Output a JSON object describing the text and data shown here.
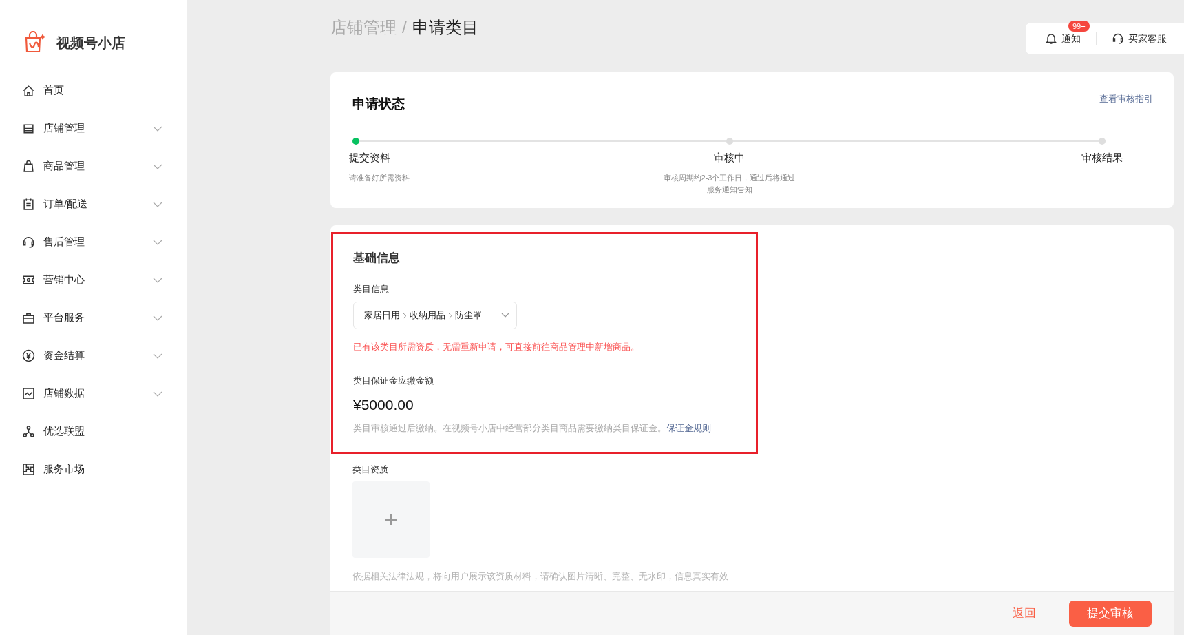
{
  "sidebar": {
    "app_name": "视频号小店",
    "items": [
      {
        "label": "首页",
        "expandable": false
      },
      {
        "label": "店铺管理",
        "expandable": true
      },
      {
        "label": "商品管理",
        "expandable": true
      },
      {
        "label": "订单/配送",
        "expandable": true
      },
      {
        "label": "售后管理",
        "expandable": true
      },
      {
        "label": "营销中心",
        "expandable": true
      },
      {
        "label": "平台服务",
        "expandable": true
      },
      {
        "label": "资金结算",
        "expandable": true
      },
      {
        "label": "店铺数据",
        "expandable": true
      },
      {
        "label": "优选联盟",
        "expandable": false
      },
      {
        "label": "服务市场",
        "expandable": false
      }
    ]
  },
  "breadcrumb": {
    "parent": "店铺管理",
    "separator": "/",
    "current": "申请类目"
  },
  "top_actions": {
    "notifications": {
      "label": "通知",
      "badge": "99+"
    },
    "support": {
      "label": "买家客服"
    }
  },
  "status_card": {
    "title": "申请状态",
    "guide_link": "查看审核指引",
    "steps": [
      {
        "label": "提交资料",
        "note": "请准备好所需资料",
        "active": true
      },
      {
        "label": "审核中",
        "note": "审核周期约2-3个工作日，通过后将通过服务通知告知",
        "active": false
      },
      {
        "label": "审核结果",
        "active": false
      }
    ]
  },
  "basic_info": {
    "title": "基础信息",
    "highlighted": true,
    "category_label": "类目信息",
    "category_path": [
      "家居日用",
      "收纳用品",
      "防尘罩"
    ],
    "warning": "已有该类目所需资质，无需重新申请，可直接前往商品管理中新增商品。",
    "deposit_label": "类目保证金应缴金额",
    "deposit_amount": "¥5000.00",
    "deposit_note": "类目审核通过后缴纳。在视频号小店中经营部分类目商品需要缴纳类目保证金。",
    "deposit_link": "保证金规则",
    "qualification_label": "类目资质",
    "upload_symbol": "+",
    "qualification_note": "依据相关法律法规，将向用户展示该资质材料，请确认图片清晰、完整、无水印，信息真实有效"
  },
  "footer": {
    "back": "返回",
    "submit": "提交审核"
  }
}
